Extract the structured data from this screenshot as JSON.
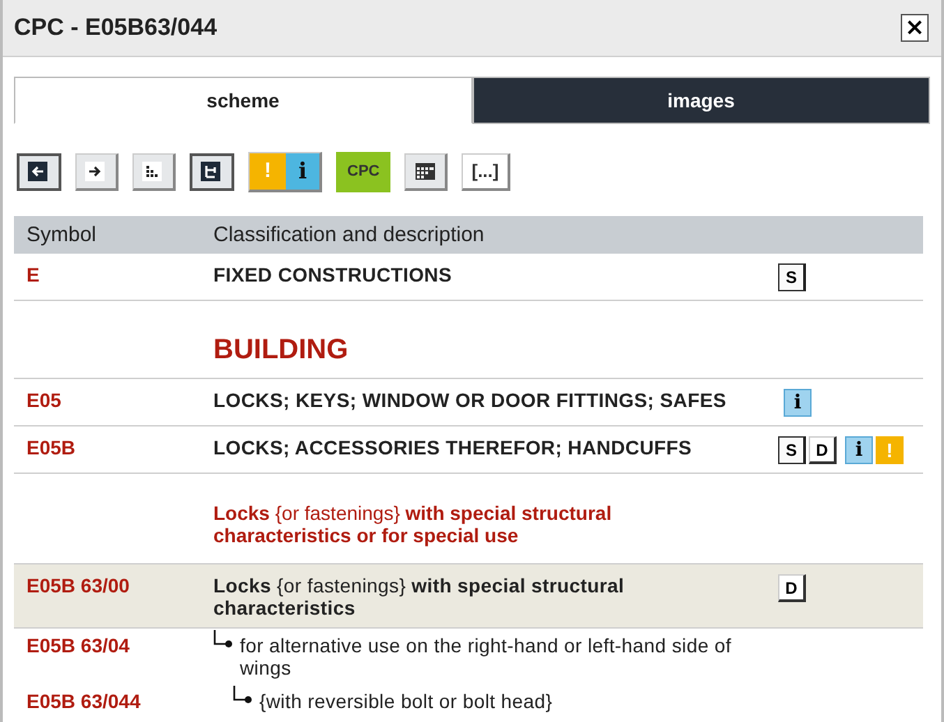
{
  "window": {
    "title": "CPC - E05B63/044",
    "close": "×"
  },
  "tabs": [
    {
      "label": "scheme",
      "selected": true
    },
    {
      "label": "images",
      "selected": false
    }
  ],
  "toolbar": [
    {
      "kind": "back",
      "pressed": true
    },
    {
      "kind": "forward",
      "pressed": false
    },
    {
      "kind": "dots",
      "pressed": false
    },
    {
      "kind": "tree",
      "pressed": true
    },
    {
      "kind": "warn-info",
      "labels": [
        "!",
        "i"
      ],
      "pressed": false
    },
    {
      "kind": "cpc",
      "label": "CPC",
      "pressed": false
    },
    {
      "kind": "grid",
      "pressed": false
    },
    {
      "kind": "more",
      "label": "[...]",
      "pressed": false
    }
  ],
  "table": {
    "columns": [
      "Symbol",
      "Classification and description"
    ],
    "rows": [
      {
        "kind": "entry",
        "symbol": "E",
        "description": "FIXED CONSTRUCTIONS",
        "badges": [
          {
            "kind": "page",
            "label": "S"
          }
        ]
      },
      {
        "kind": "heading",
        "description": "BUILDING"
      },
      {
        "kind": "entry",
        "symbol": "E05",
        "description": "LOCKS; KEYS; WINDOW OR DOOR FITTINGS; SAFES",
        "badges": [
          {
            "kind": "info",
            "label": "i"
          }
        ]
      },
      {
        "kind": "entry",
        "symbol": "E05B",
        "description": "LOCKS; ACCESSORIES THEREFOR; HANDCUFFS",
        "badges": [
          {
            "kind": "page",
            "label": "S"
          },
          {
            "kind": "box",
            "label": "D"
          },
          {
            "kind": "info",
            "label": "i"
          },
          {
            "kind": "warning",
            "label": "!"
          }
        ]
      },
      {
        "kind": "subheading",
        "description": "**Locks** {or fastenings} **with special structural characteristics or for special use**"
      },
      {
        "kind": "entry",
        "symbol": "E05B 63/00",
        "selected": true,
        "description": "**Locks** {or fastenings} **with special structural characteristics**",
        "badges": [
          {
            "kind": "box",
            "label": "D"
          }
        ],
        "children": [
          {
            "kind": "entry",
            "symbol": "E05B 63/04",
            "selected": false,
            "description": "for alternative use on the right-hand or left-hand side of wings",
            "children": [
              {
                "kind": "entry",
                "symbol": "E05B 63/044",
                "selected": false,
                "description": "{with reversible bolt or bolt head}"
              }
            ]
          }
        ]
      }
    ]
  }
}
